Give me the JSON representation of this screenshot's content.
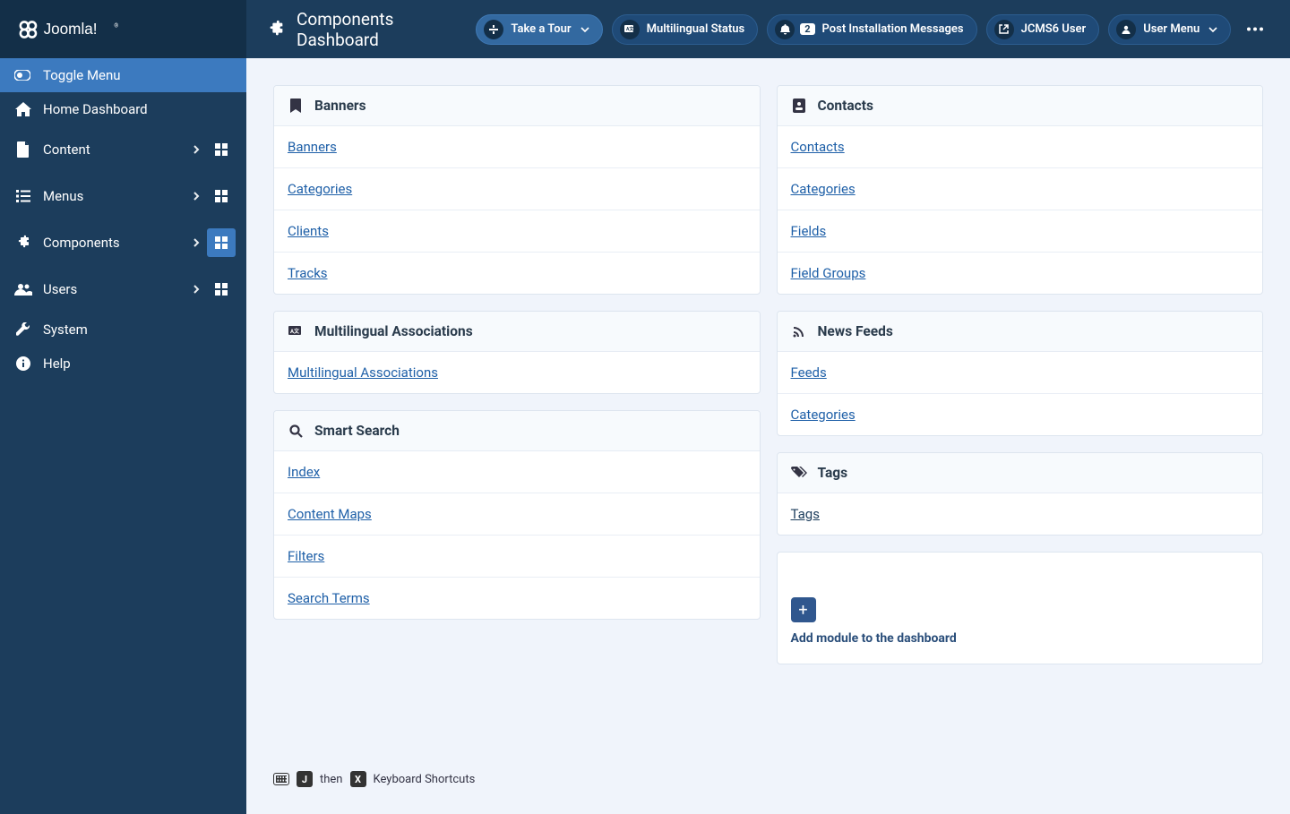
{
  "brand": "Joomla!",
  "page_title": "Components Dashboard",
  "topbar": {
    "take_tour": "Take a Tour",
    "multilingual_status": "Multilingual Status",
    "post_install": "Post Installation Messages",
    "post_install_badge": "2",
    "site_name": "JCMS6 User",
    "user_menu": "User Menu"
  },
  "sidebar": {
    "toggle": "Toggle Menu",
    "items": [
      {
        "label": "Home Dashboard",
        "icon": "home",
        "expandable": false,
        "dashboard": false,
        "active": false
      },
      {
        "label": "Content",
        "icon": "file",
        "expandable": true,
        "dashboard": true,
        "active": false
      },
      {
        "label": "Menus",
        "icon": "list",
        "expandable": true,
        "dashboard": true,
        "active": false
      },
      {
        "label": "Components",
        "icon": "puzzle",
        "expandable": true,
        "dashboard": true,
        "active": true
      },
      {
        "label": "Users",
        "icon": "users",
        "expandable": true,
        "dashboard": true,
        "active": false
      },
      {
        "label": "System",
        "icon": "wrench",
        "expandable": false,
        "dashboard": false,
        "active": false
      },
      {
        "label": "Help",
        "icon": "info",
        "expandable": false,
        "dashboard": false,
        "active": false
      }
    ]
  },
  "panels": {
    "left": [
      {
        "title": "Banners",
        "icon": "bookmark",
        "links": [
          "Banners",
          "Categories",
          "Clients",
          "Tracks"
        ]
      },
      {
        "title": "Multilingual Associations",
        "icon": "lang",
        "links": [
          "Multilingual Associations"
        ]
      },
      {
        "title": "Smart Search",
        "icon": "search",
        "links": [
          "Index",
          "Content Maps",
          "Filters",
          "Search Terms"
        ]
      }
    ],
    "right": [
      {
        "title": "Contacts",
        "icon": "card",
        "links": [
          "Contacts",
          "Categories",
          "Fields",
          "Field Groups"
        ]
      },
      {
        "title": "News Feeds",
        "icon": "rss",
        "links": [
          "Feeds",
          "Categories"
        ]
      },
      {
        "title": "Tags",
        "icon": "tags",
        "links": [
          "Tags"
        ],
        "dark": true
      }
    ]
  },
  "add_module": "Add module to the dashboard",
  "shortcuts": {
    "key1": "J",
    "then": "then",
    "key2": "X",
    "label": "Keyboard Shortcuts"
  }
}
